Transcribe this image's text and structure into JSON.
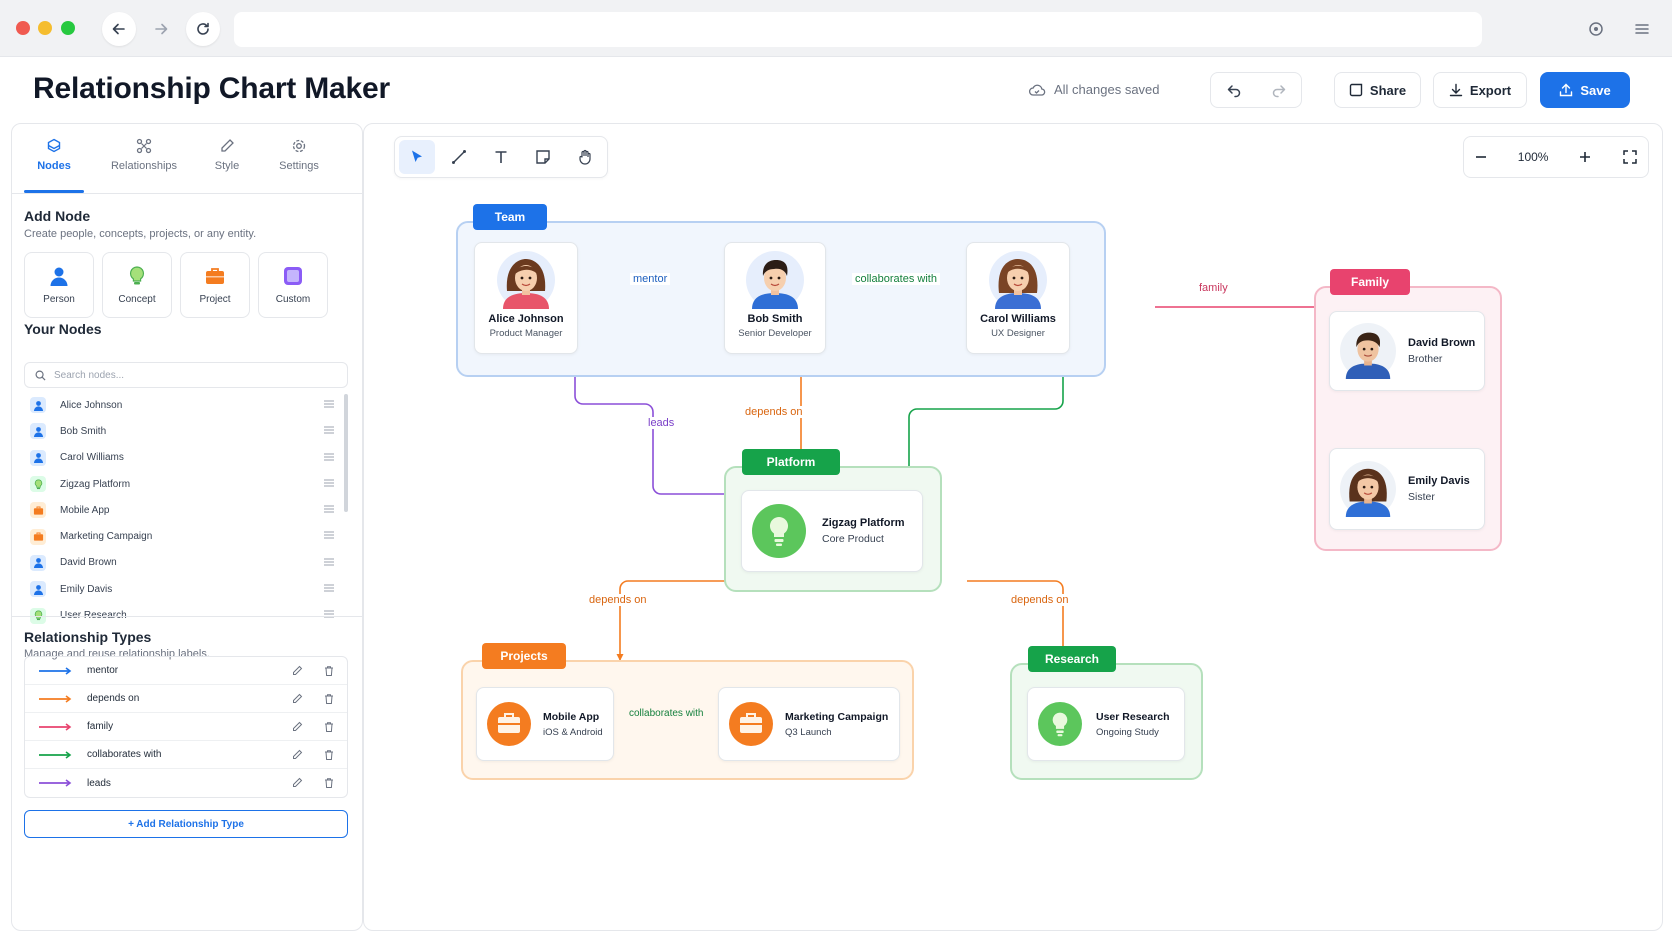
{
  "app": {
    "title": "Relationship Chart Maker",
    "save_status": "All changes saved",
    "share_label": "Share",
    "export_label": "Export",
    "save_label": "Save"
  },
  "sidebar": {
    "tabs": [
      {
        "label": "Nodes",
        "icon": "nodes-icon",
        "active": true
      },
      {
        "label": "Relationships",
        "icon": "relationships-icon"
      },
      {
        "label": "Style",
        "icon": "pen-icon"
      },
      {
        "label": "Settings",
        "icon": "gear-icon"
      }
    ],
    "add_node": {
      "title": "Add Node",
      "subtitle": "Create people, concepts, projects, or any entity.",
      "types": [
        {
          "label": "Person",
          "icon": "person-icon",
          "color": "#1d72e8"
        },
        {
          "label": "Concept",
          "icon": "lightbulb-icon",
          "color": "#4caf50"
        },
        {
          "label": "Project",
          "icon": "briefcase-icon",
          "color": "#f47c20"
        },
        {
          "label": "Custom",
          "icon": "custom-square-icon",
          "color": "#8b5cf6"
        }
      ]
    },
    "your_nodes": {
      "title": "Your Nodes",
      "search_placeholder": "Search nodes...",
      "items": [
        {
          "label": "Alice Johnson",
          "type": "person"
        },
        {
          "label": "Bob Smith",
          "type": "person"
        },
        {
          "label": "Carol Williams",
          "type": "person"
        },
        {
          "label": "Zigzag Platform",
          "type": "concept"
        },
        {
          "label": "Mobile App",
          "type": "project"
        },
        {
          "label": "Marketing Campaign",
          "type": "project"
        },
        {
          "label": "David Brown",
          "type": "person"
        },
        {
          "label": "Emily Davis",
          "type": "person"
        },
        {
          "label": "User Research",
          "type": "concept"
        }
      ]
    },
    "relationship_types": {
      "title": "Relationship Types",
      "subtitle": "Manage and reuse relationship labels.",
      "items": [
        {
          "label": "mentor",
          "color": "#1d72e8"
        },
        {
          "label": "depends on",
          "color": "#f47c20"
        },
        {
          "label": "family",
          "color": "#e8436e"
        },
        {
          "label": "collaborates with",
          "color": "#16a34a"
        },
        {
          "label": "leads",
          "color": "#8b4fd8"
        }
      ],
      "add_label": "+ Add Relationship Type"
    }
  },
  "canvas": {
    "zoom": "100%",
    "tools": [
      "select-tool",
      "connector-tool",
      "text-tool",
      "note-tool",
      "pan-tool"
    ],
    "groups": {
      "team": {
        "label": "Team",
        "color": "#1d72e8"
      },
      "family": {
        "label": "Family",
        "color": "#e8436e"
      },
      "platform": {
        "label": "Platform",
        "color": "#16a34a"
      },
      "projects": {
        "label": "Projects",
        "color": "#f47c20"
      },
      "research": {
        "label": "Research",
        "color": "#16a34a"
      }
    },
    "nodes": {
      "alice": {
        "name": "Alice Johnson",
        "role": "Product Manager"
      },
      "bob": {
        "name": "Bob Smith",
        "role": "Senior Developer"
      },
      "carol": {
        "name": "Carol Williams",
        "role": "UX Designer"
      },
      "david": {
        "name": "David Brown",
        "role": "Brother"
      },
      "emily": {
        "name": "Emily Davis",
        "role": "Sister"
      },
      "zigzag": {
        "name": "Zigzag Platform",
        "role": "Core Product"
      },
      "mobile": {
        "name": "Mobile App",
        "role": "iOS & Android"
      },
      "marketing": {
        "name": "Marketing Campaign",
        "role": "Q3 Launch"
      },
      "research": {
        "name": "User Research",
        "role": "Ongoing Study"
      }
    },
    "edges": {
      "mentor": "mentor",
      "collab_team": "collaborates with",
      "family": "family",
      "leads": "leads",
      "depends_platform": "depends on",
      "depends_projects": "depends on",
      "depends_research": "depends on",
      "collab_projects": "collaborates with"
    }
  }
}
